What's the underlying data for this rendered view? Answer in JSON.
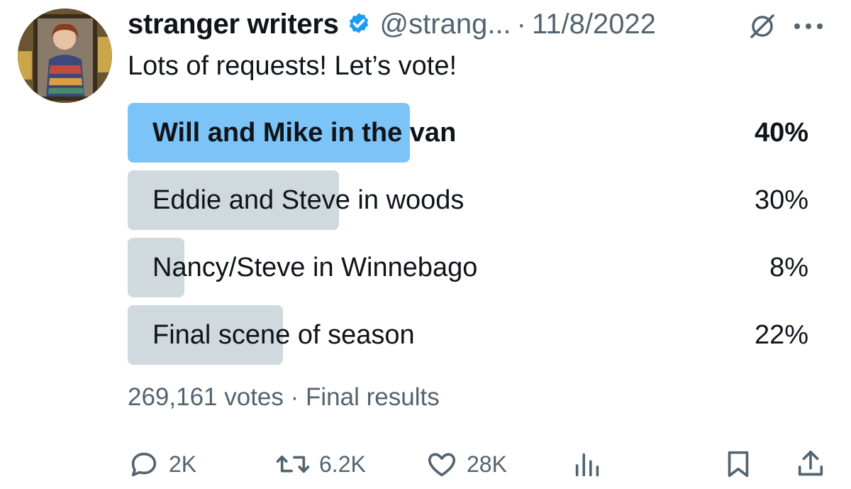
{
  "author": {
    "display_name": "stranger writers",
    "handle": "@strang...",
    "separator": "·",
    "date": "11/8/2022",
    "verified_color": "#1d9bf0"
  },
  "tweet": {
    "text": "Lots of requests! Let’s vote!"
  },
  "poll": {
    "options": [
      {
        "label": "Will and Mike in the van",
        "percent_text": "40%",
        "share": 0.4,
        "winner": true
      },
      {
        "label": "Eddie and Steve in woods",
        "percent_text": "30%",
        "share": 0.3,
        "winner": false
      },
      {
        "label": "Nancy/Steve in Winnebago",
        "percent_text": "8%",
        "share": 0.08,
        "winner": false
      },
      {
        "label": "Final scene of season",
        "percent_text": "22%",
        "share": 0.22,
        "winner": false
      }
    ],
    "votes": "269,161 votes",
    "separator": "·",
    "status": "Final results",
    "winner_color": "#7cc3f8",
    "other_color": "#cfd9de"
  },
  "actions": {
    "reply_count": "2K",
    "retweet_count": "6.2K",
    "like_count": "28K"
  },
  "icons": {
    "verified": "verified-badge-icon",
    "grok": "grok-icon",
    "more": "more-icon",
    "reply": "reply-icon",
    "retweet": "retweet-icon",
    "like": "heart-icon",
    "views": "views-icon",
    "bookmark": "bookmark-icon",
    "share": "share-icon"
  }
}
